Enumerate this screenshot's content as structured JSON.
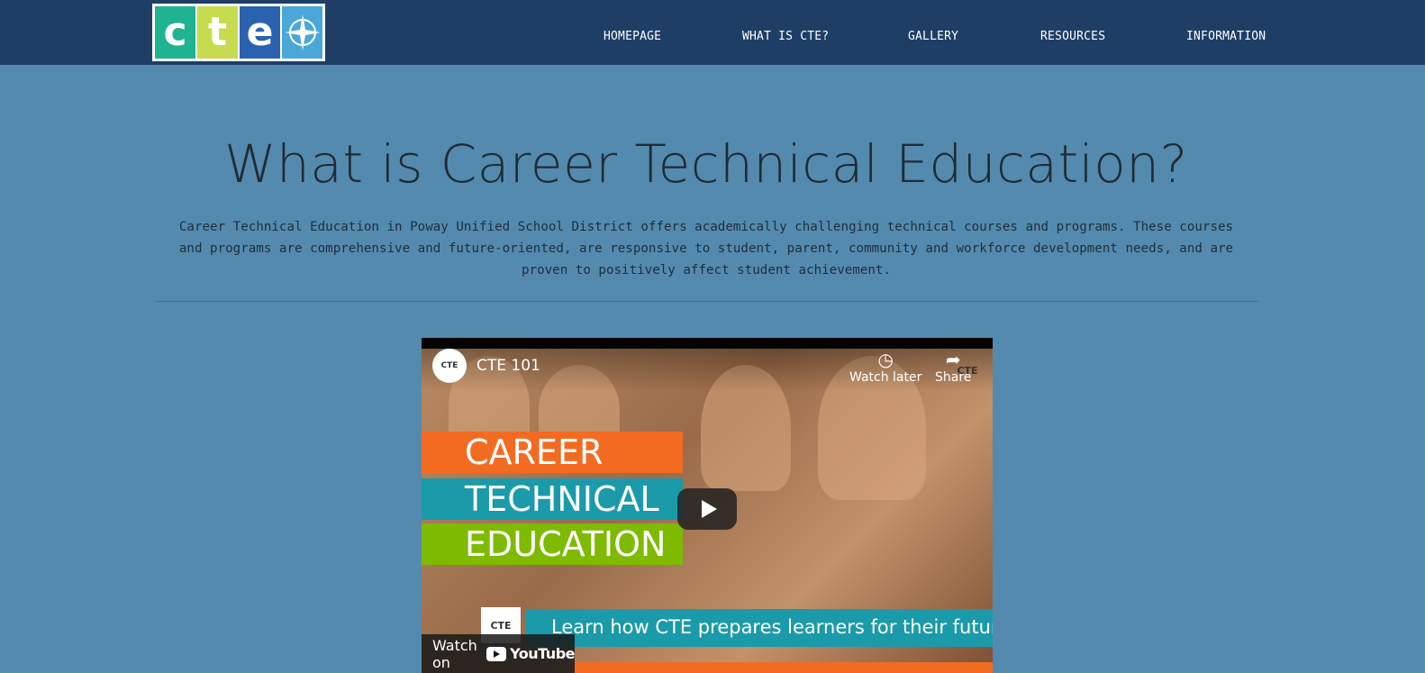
{
  "header": {
    "logo_letters": [
      "c",
      "t",
      "e"
    ],
    "logo_icon": "compass-rose-icon",
    "nav": [
      {
        "label": "HOMEPAGE"
      },
      {
        "label": "WHAT IS CTE?"
      },
      {
        "label": "GALLERY"
      },
      {
        "label": "RESOURCES"
      },
      {
        "label": "INFORMATION"
      }
    ]
  },
  "main": {
    "title": "What is Career Technical Education?",
    "description": "Career Technical Education in Poway Unified School District offers academically challenging technical courses and programs. These courses and programs are comprehensive and future-oriented, are responsive to student, parent, community and workforce development needs, and are proven to positively affect student achievement."
  },
  "video": {
    "channel_badge": "CTE",
    "title": "CTE 101",
    "watch_later": "Watch later",
    "share": "Share",
    "thumbnail_bands": [
      "CAREER",
      "TECHNICAL",
      "EDUCATION"
    ],
    "caption": "Learn how CTE prepares learners for their future.",
    "watch_on": "Watch on",
    "youtube": "YouTube"
  },
  "colors": {
    "header_bg": "#1e3e66",
    "page_bg": "#548aae",
    "orange": "#f36b21",
    "teal": "#1b9aaa",
    "green": "#7dba00"
  }
}
